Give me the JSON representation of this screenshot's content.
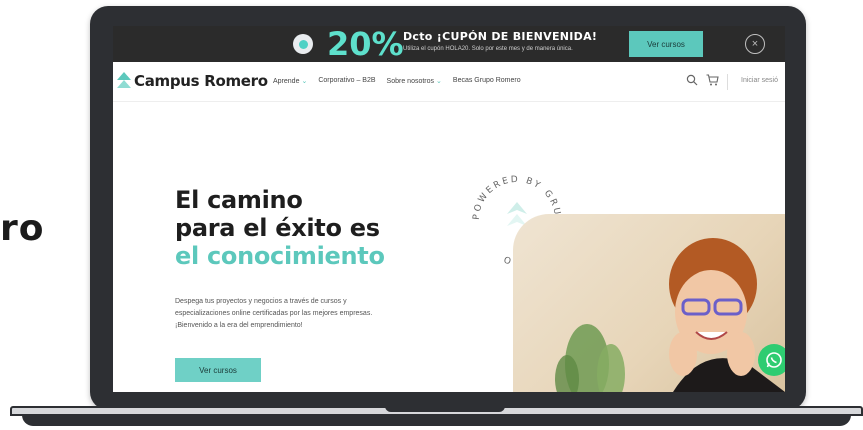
{
  "background_text": "ro",
  "promo": {
    "percent": "20%",
    "title": "Dcto ¡CUPÓN DE BIENVENIDA!",
    "subtitle": "Utiliza el cupón HOLA20. Solo por este mes y de manera única.",
    "button_label": "Ver cursos",
    "close_icon": "×"
  },
  "nav": {
    "brand": "Campus Romero",
    "items": [
      {
        "label": "Aprende",
        "has_caret": true
      },
      {
        "label": "Corporativo – B2B",
        "has_caret": false
      },
      {
        "label": "Sobre nosotros",
        "has_caret": true
      },
      {
        "label": "Becas Grupo Romero",
        "has_caret": false
      }
    ],
    "caret": "⌄",
    "login_label": "Iniciar sesió"
  },
  "hero": {
    "title_line1": "El camino",
    "title_line2": "para el éxito es",
    "title_line3": "el conocimiento",
    "desc_line1": "Despega tus proyectos y negocios a través de cursos y",
    "desc_line2": "especializaciones online certificadas por las mejores empresas.",
    "desc_line3": "¡Bienvenido a la era del emprendimiento!",
    "button_label": "Ver cursos"
  },
  "badge": {
    "text": "POWERED BY GRUPO ROMERO"
  },
  "colors": {
    "accent": "#5cc8bc",
    "promo_bg": "#2b2b2b",
    "frame": "#2d2f33",
    "whatsapp": "#2ecc71"
  }
}
